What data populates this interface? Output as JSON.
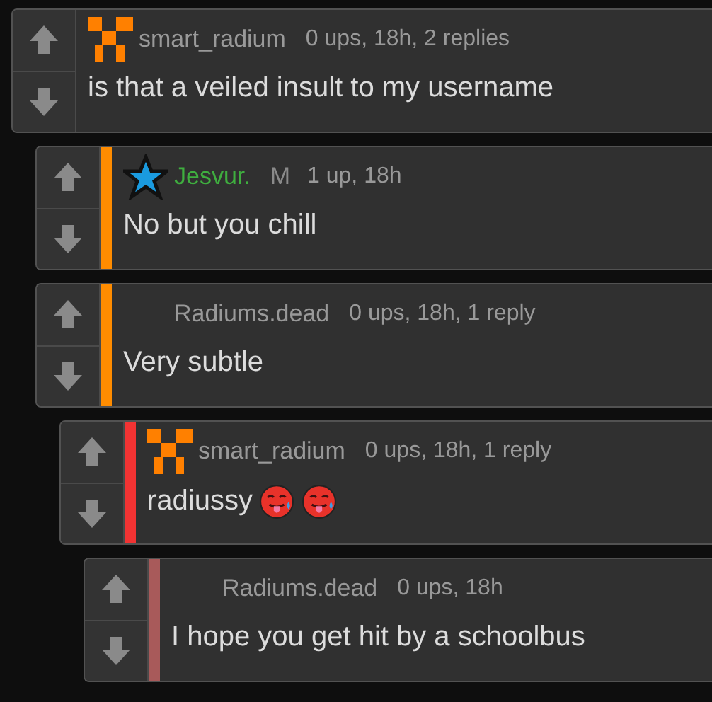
{
  "comments": [
    {
      "avatar": {
        "kind": "pixel"
      },
      "user": {
        "name": "smart_radium",
        "color": "#999999"
      },
      "meta": "0 ups, 18h, 2 replies",
      "text": "is that a veiled insult to my username",
      "children": [
        {
          "avatar": {
            "kind": "star"
          },
          "user": {
            "name": "Jesvur.",
            "color": "#3fae3f"
          },
          "badge": "M",
          "meta": "1 up, 18h",
          "text": "No but you chill",
          "bar": {
            "color": "#ff8c00"
          }
        },
        {
          "user": {
            "name": "Radiums.dead",
            "color": "#999999"
          },
          "meta": "0 ups, 18h, 1 reply",
          "text": "Very subtle",
          "bar": {
            "color": "#ff8c00"
          },
          "children": [
            {
              "avatar": {
                "kind": "pixel"
              },
              "user": {
                "name": "smart_radium",
                "color": "#999999"
              },
              "meta": "0 ups, 18h, 1 reply",
              "text": "radiussy",
              "reactions": [
                {
                  "kind": "hot-face"
                },
                {
                  "kind": "hot-face"
                }
              ],
              "bar": {
                "color": "#f23333"
              },
              "children": [
                {
                  "user": {
                    "name": "Radiums.dead",
                    "color": "#999999"
                  },
                  "meta": "0 ups, 18h",
                  "text": "I hope you get hit by a schoolbus",
                  "bar": {
                    "color": "#a85a5a"
                  }
                }
              ]
            }
          ]
        }
      ]
    }
  ]
}
